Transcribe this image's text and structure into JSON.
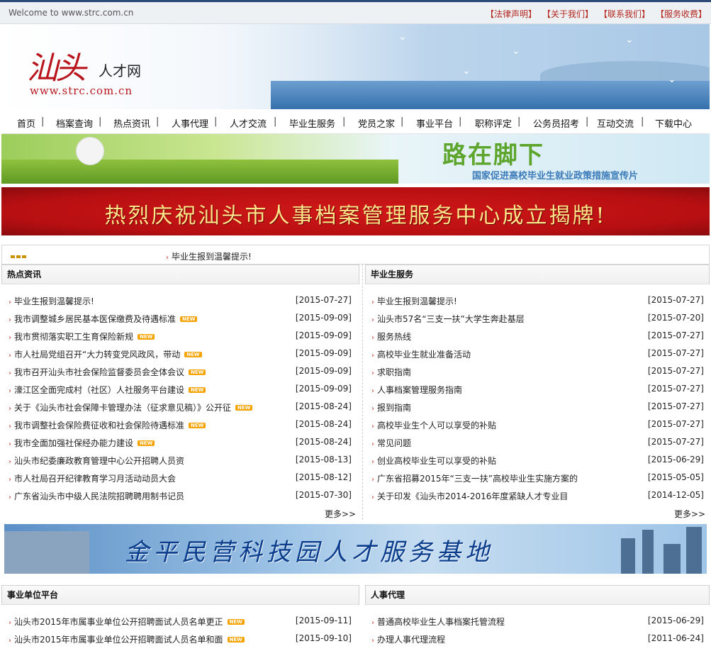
{
  "topbar": {
    "welcome": "Welcome to www.strc.com.cn",
    "links": [
      "【法律声明】",
      "【关于我们】",
      "【联系我们】",
      "【服务收费】"
    ]
  },
  "header": {
    "logo_main": "汕头",
    "logo_sub": "人才网",
    "logo_url": "www.strc.com.cn"
  },
  "nav": {
    "items": [
      "首页",
      "档案查询",
      "热点资讯",
      "人事代理",
      "人才交流",
      "毕业生服务",
      "党员之家",
      "事业平台",
      "职称评定",
      "公务员招考",
      "互动交流",
      "下载中心"
    ]
  },
  "banner1": {
    "title": "路在脚下",
    "subtitle": "国家促进高校毕业生就业政策措施宣传片"
  },
  "banner2": {
    "text": "热烈庆祝汕头市人事档案管理服务中心成立揭牌!"
  },
  "notice": {
    "text": "毕业生报到温馨提示!"
  },
  "hot_news": {
    "title": "热点资讯",
    "more": "更多>>",
    "items": [
      {
        "text": "毕业生报到温馨提示!",
        "date": "[2015-07-27]",
        "new": false
      },
      {
        "text": "我市调整城乡居民基本医保缴费及待遇标准",
        "date": "[2015-09-09]",
        "new": true
      },
      {
        "text": "我市贯彻落实职工生育保险新规",
        "date": "[2015-09-09]",
        "new": true
      },
      {
        "text": "市人社局党组召开“大力转变党风政风，带动",
        "date": "[2015-09-09]",
        "new": true
      },
      {
        "text": "我市召开汕头市社会保险监督委员会全体会议",
        "date": "[2015-09-09]",
        "new": true
      },
      {
        "text": "濠江区全面完成村（社区）人社服务平台建设",
        "date": "[2015-09-09]",
        "new": true
      },
      {
        "text": "关于《汕头市社会保障卡管理办法（征求意见稿）》公开征",
        "date": "[2015-08-24]",
        "new": true
      },
      {
        "text": "我市调整社会保险费征收和社会保险待遇标准",
        "date": "[2015-08-24]",
        "new": true
      },
      {
        "text": "我市全面加强社保经办能力建设",
        "date": "[2015-08-24]",
        "new": true
      },
      {
        "text": "汕头市纪委廉政教育管理中心公开招聘人员资",
        "date": "[2015-08-13]",
        "new": false
      },
      {
        "text": "市人社局召开纪律教育学习月活动动员大会",
        "date": "[2015-08-12]",
        "new": false
      },
      {
        "text": "广东省汕头市中级人民法院招聘聘用制书记员",
        "date": "[2015-07-30]",
        "new": false
      }
    ]
  },
  "graduate": {
    "title": "毕业生服务",
    "more": "更多>>",
    "items": [
      {
        "text": "毕业生报到温馨提示!",
        "date": "[2015-07-27]"
      },
      {
        "text": "汕头市57名“三支一扶”大学生奔赴基层",
        "date": "[2015-07-20]"
      },
      {
        "text": "服务热线",
        "date": "[2015-07-27]"
      },
      {
        "text": "高校毕业生就业准备活动",
        "date": "[2015-07-27]"
      },
      {
        "text": "求职指南",
        "date": "[2015-07-27]"
      },
      {
        "text": "人事档案管理服务指南",
        "date": "[2015-07-27]"
      },
      {
        "text": "报到指南",
        "date": "[2015-07-27]"
      },
      {
        "text": "高校毕业生个人可以享受的补贴",
        "date": "[2015-07-27]"
      },
      {
        "text": "常见问题",
        "date": "[2015-07-27]"
      },
      {
        "text": "创业高校毕业生可以享受的补贴",
        "date": "[2015-06-29]"
      },
      {
        "text": "广东省招募2015年“三支一扶”高校毕业生实施方案的",
        "date": "[2015-05-05]"
      },
      {
        "text": "关于印发《汕头市2014-2016年度紧缺人才专业目",
        "date": "[2014-12-05]"
      }
    ]
  },
  "banner3": {
    "text": "金平民营科技园人才服务基地"
  },
  "public_inst": {
    "title": "事业单位平台",
    "items": [
      {
        "text": "汕头市2015年市属事业单位公开招聘面试人员名单更正",
        "date": "[2015-09-11]",
        "new": true
      },
      {
        "text": "汕头市2015年市属事业单位公开招聘面试人员名单和面",
        "date": "[2015-09-10]",
        "new": true
      }
    ]
  },
  "agency": {
    "title": "人事代理",
    "items": [
      {
        "text": "普通高校毕业生人事档案托管流程",
        "date": "[2015-06-29]"
      },
      {
        "text": "办理人事代理流程",
        "date": "[2011-06-24]"
      }
    ]
  },
  "new_badge": "NEW"
}
